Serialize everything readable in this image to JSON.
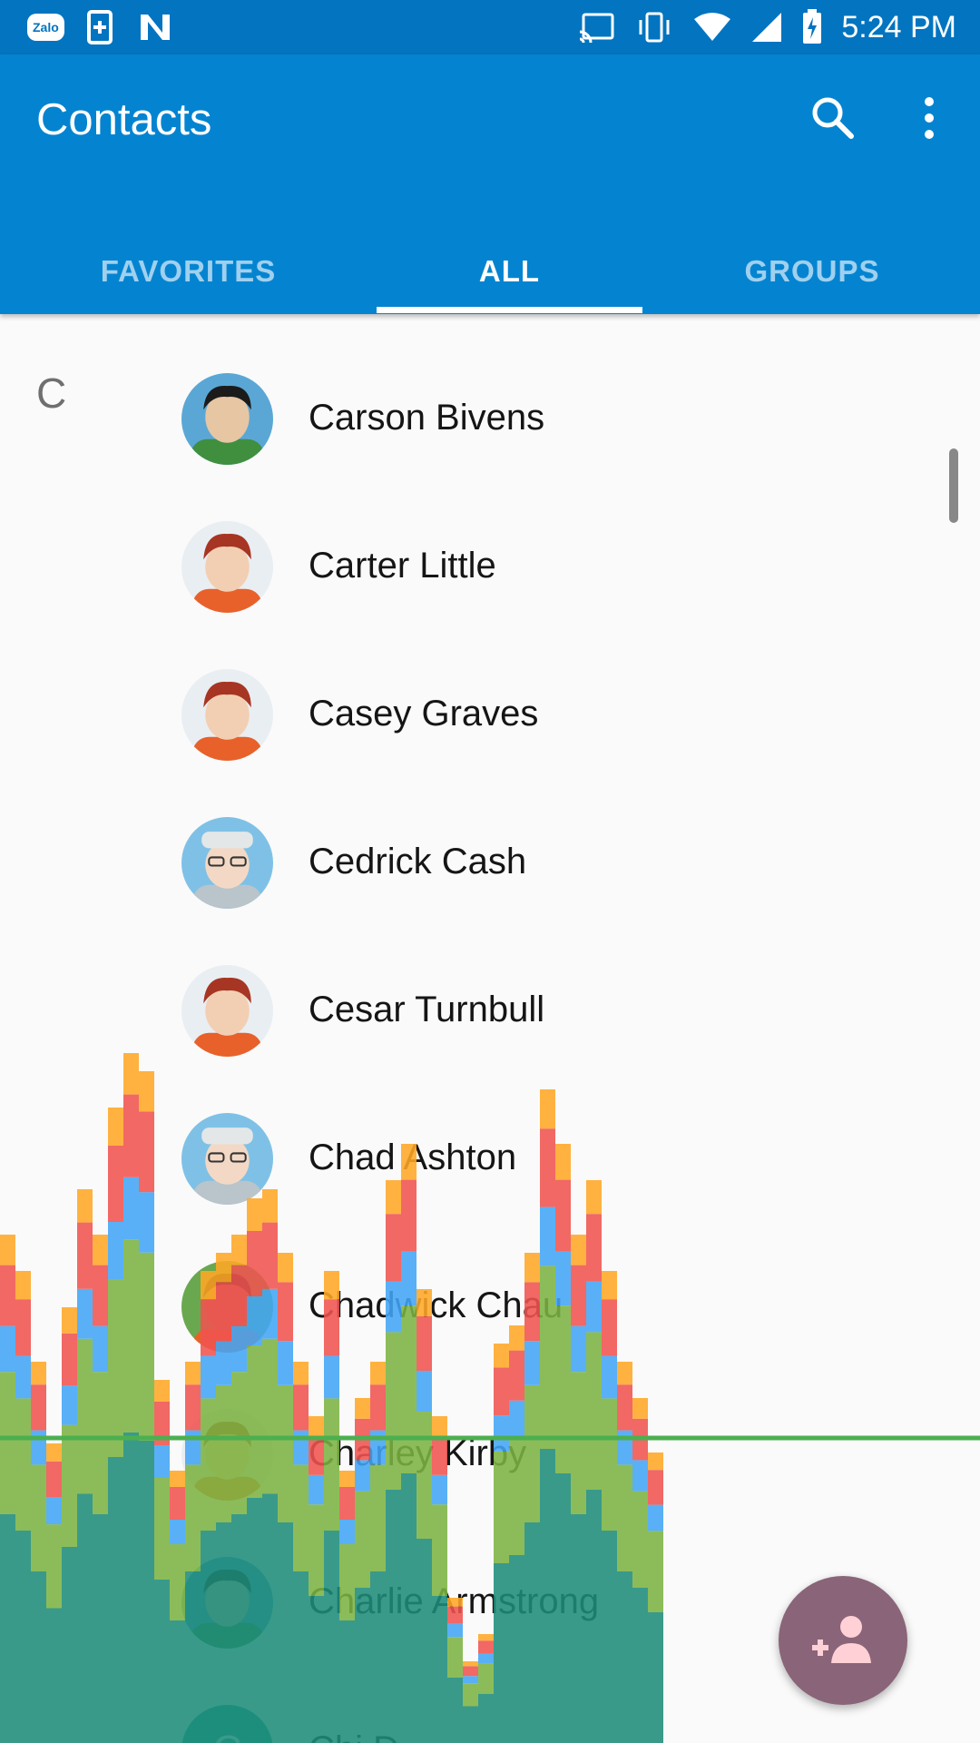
{
  "status_bar": {
    "left_icons": [
      "zalo-icon",
      "sim-add-icon",
      "n-app-icon"
    ],
    "zalo_text": "Zalo",
    "right_icons": [
      "cast-icon",
      "vibrate-icon",
      "wifi-icon",
      "cell-signal-icon",
      "battery-charging-icon"
    ],
    "time": "5:24 PM"
  },
  "app_bar": {
    "title": "Contacts",
    "actions": [
      "search-icon",
      "more-vert-icon"
    ],
    "color": "#0484d0"
  },
  "tabs": [
    {
      "label": "FAVORITES",
      "active": false
    },
    {
      "label": "ALL",
      "active": true
    },
    {
      "label": "GROUPS",
      "active": false
    }
  ],
  "list": {
    "section_letter": "C",
    "contacts": [
      {
        "name": "Carson Bivens",
        "avatar": "avatar-dark-hair-green-shirt"
      },
      {
        "name": "Carter Little",
        "avatar": "avatar-red-hair-orange-shirt"
      },
      {
        "name": "Casey Graves",
        "avatar": "avatar-red-hair-orange-shirt"
      },
      {
        "name": "Cedrick Cash",
        "avatar": "avatar-hat-glasses-blue"
      },
      {
        "name": "Cesar Turnbull",
        "avatar": "avatar-red-hair-orange-shirt"
      },
      {
        "name": "Chad Ashton",
        "avatar": "avatar-hat-glasses-blue"
      },
      {
        "name": "Chadwick Chau",
        "avatar": "avatar-dark-skin-green"
      },
      {
        "name": "Charley Kirby",
        "avatar": "avatar-red-hair-orange-shirt"
      },
      {
        "name": "Charlie Armstrong",
        "avatar": "avatar-dark-hair-green-shirt"
      },
      {
        "name": "Chi D...",
        "avatar": "avatar-teal-letter-c"
      }
    ]
  },
  "fab": {
    "icon": "add-contact-icon"
  },
  "gpu_profile_overlay": {
    "segment_colors": [
      "#1e8c7a",
      "#7cb342",
      "#42a5f5",
      "#ef5350",
      "#ffa726"
    ],
    "threshold_line_color": "#4caf50"
  }
}
